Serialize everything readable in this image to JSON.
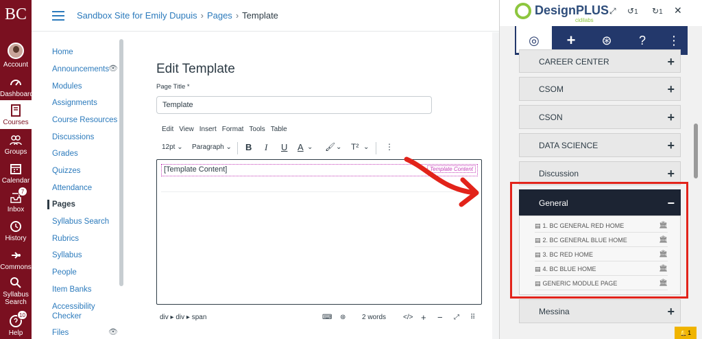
{
  "global_nav": {
    "logo": "BC",
    "items": [
      {
        "label": "Account"
      },
      {
        "label": "Dashboard"
      },
      {
        "label": "Courses"
      },
      {
        "label": "Groups"
      },
      {
        "label": "Calendar"
      },
      {
        "label": "Inbox",
        "badge": "7"
      },
      {
        "label": "History"
      },
      {
        "label": "Commons"
      },
      {
        "label": "Syllabus Search"
      },
      {
        "label": "Help",
        "badge": "10"
      }
    ]
  },
  "breadcrumb": {
    "course": "Sandbox Site for Emily Dupuis",
    "section": "Pages",
    "current": "Template",
    "separator": "›"
  },
  "course_nav": [
    "Home",
    "Announcements",
    "Modules",
    "Assignments",
    "Course Resources",
    "Discussions",
    "Grades",
    "Quizzes",
    "Attendance",
    "Pages",
    "Syllabus Search",
    "Rubrics",
    "Syllabus",
    "People",
    "Item Banks",
    "Accessibility Checker",
    "Files"
  ],
  "editor": {
    "heading": "Edit Template",
    "page_title_label": "Page Title *",
    "page_title_value": "Template",
    "menu": [
      "Edit",
      "View",
      "Insert",
      "Format",
      "Tools",
      "Table"
    ],
    "font_size": "12pt",
    "block_format": "Paragraph",
    "content_text": "[Template Content]",
    "content_tag": "Template Content",
    "path": "div ▸ div ▸ span",
    "word_count": "2 words"
  },
  "designplus": {
    "brand": "DesignPLUS",
    "sub_brand": "cidilabs",
    "undo_count": "1",
    "redo_count": "1",
    "categories": [
      {
        "label": "CAREER CENTER"
      },
      {
        "label": "CSOM"
      },
      {
        "label": "CSON"
      },
      {
        "label": "DATA SCIENCE"
      },
      {
        "label": "Discussion"
      },
      {
        "label": "General",
        "open": true
      },
      {
        "label": "Messina"
      }
    ],
    "general_items": [
      "1. BC GENERAL RED HOME",
      "2. BC GENERAL BLUE HOME",
      "3. BC RED HOME",
      "4. BC BLUE HOME",
      "GENERIC MODULE PAGE"
    ],
    "alert_count": "1"
  },
  "colors": {
    "nav_bg": "#7a1020",
    "link": "#2b7abc",
    "dp_tab_bg": "#23386b",
    "dp_open_bg": "#1c2433",
    "highlight": "#e2231a",
    "template_tag": "#c43fb8"
  }
}
